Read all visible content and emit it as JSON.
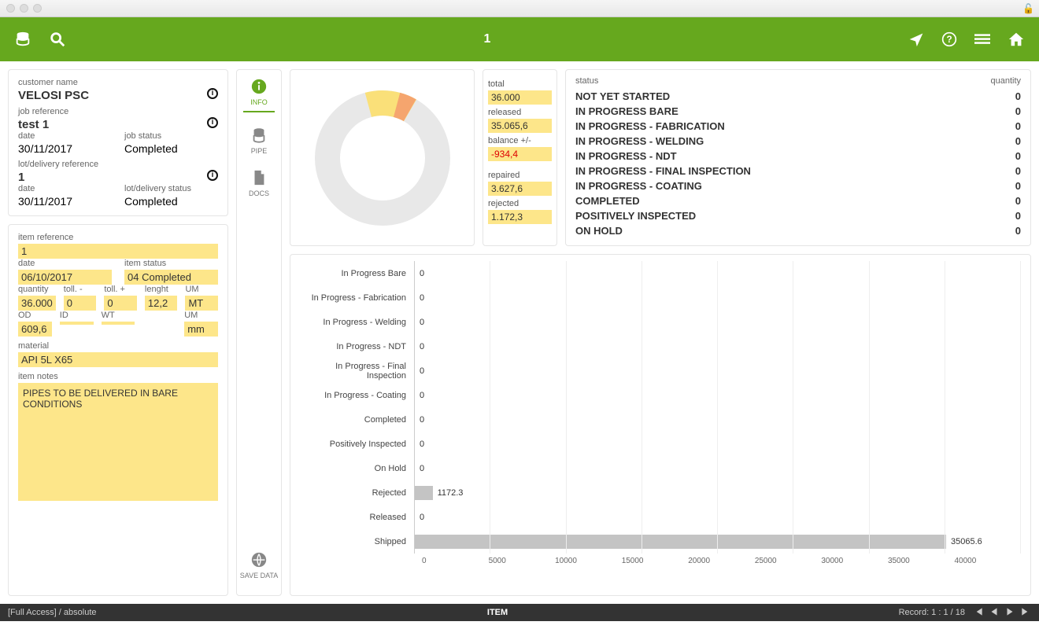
{
  "header": {
    "title": "1"
  },
  "customer": {
    "name_label": "customer name",
    "name": "VELOSI PSC",
    "job_ref_label": "job reference",
    "job_ref": "test 1",
    "date_label": "date",
    "date": "30/11/2017",
    "job_status_label": "job status",
    "job_status": "Completed",
    "lot_ref_label": "lot/delivery reference",
    "lot_ref": "1",
    "lot_date_label": "date",
    "lot_date": "30/11/2017",
    "lot_status_label": "lot/delivery status",
    "lot_status": "Completed"
  },
  "item": {
    "ref_label": "item reference",
    "ref": "1",
    "date_label": "date",
    "date": "06/10/2017",
    "status_label": "item status",
    "status": "04 Completed",
    "qty_label": "quantity",
    "qty": "36.000",
    "tolm_label": "toll. -",
    "tolm": "0",
    "tolp_label": "toll. +",
    "tolp": "0",
    "len_label": "lenght",
    "len": "12,2",
    "um_label": "UM",
    "um": "MT",
    "od_label": "OD",
    "od": "609,6",
    "id_label": "ID",
    "id": "",
    "wt_label": "WT",
    "wt": "",
    "um2_label": "UM",
    "um2": "mm",
    "material_label": "material",
    "material": "API 5L X65",
    "notes_label": "item notes",
    "notes": "PIPES TO BE DELIVERED IN BARE CONDITIONS"
  },
  "sidenav": {
    "info": "INFO",
    "pipe": "PIPE",
    "docs": "DOCS",
    "save": "SAVE DATA"
  },
  "stats": {
    "total_label": "total",
    "total": "36.000",
    "released_label": "released",
    "released": "35.065,6",
    "balance_label": "balance +/-",
    "balance": "-934,4",
    "repaired_label": "repaired",
    "repaired": "3.627,6",
    "rejected_label": "rejected",
    "rejected": "1.172,3"
  },
  "status_table": {
    "col1": "status",
    "col2": "quantity",
    "rows": [
      {
        "name": "NOT YET STARTED",
        "q": "0"
      },
      {
        "name": "IN PROGRESS BARE",
        "q": "0"
      },
      {
        "name": "IN PROGRESS - FABRICATION",
        "q": "0"
      },
      {
        "name": "IN PROGRESS - WELDING",
        "q": "0"
      },
      {
        "name": "IN PROGRESS - NDT",
        "q": "0"
      },
      {
        "name": "IN PROGRESS - FINAL INSPECTION",
        "q": "0"
      },
      {
        "name": "IN PROGRESS - COATING",
        "q": "0"
      },
      {
        "name": "COMPLETED",
        "q": "0"
      },
      {
        "name": "POSITIVELY INSPECTED",
        "q": "0"
      },
      {
        "name": "ON HOLD",
        "q": "0"
      }
    ]
  },
  "chart_data": {
    "type": "bar",
    "xlim": [
      0,
      40000
    ],
    "ticks": [
      "0",
      "5000",
      "10000",
      "15000",
      "20000",
      "25000",
      "30000",
      "35000",
      "40000"
    ],
    "categories": [
      "In Progress Bare",
      "In Progress - Fabrication",
      "In Progress - Welding",
      "In Progress - NDT",
      "In Progress - Final Inspection",
      "In Progress - Coating",
      "Completed",
      "Positively Inspected",
      "On Hold",
      "Rejected",
      "Released",
      "Shipped"
    ],
    "values": [
      0,
      0,
      0,
      0,
      0,
      0,
      0,
      0,
      0,
      1172.3,
      0,
      35065.6
    ]
  },
  "footer": {
    "left": "[Full Access] / absolute",
    "center": "ITEM",
    "record": "Record: 1 : 1 / 18"
  }
}
